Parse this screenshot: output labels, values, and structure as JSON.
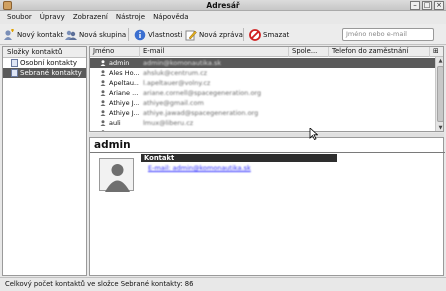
{
  "window": {
    "title": "Adresář"
  },
  "menu": [
    "Soubor",
    "Úpravy",
    "Zobrazení",
    "Nástroje",
    "Nápověda"
  ],
  "toolbar": {
    "new_contact": "Nový kontakt",
    "new_group": "Nová skupina",
    "properties": "Vlastnosti",
    "new_message": "Nová zpráva",
    "delete": "Smazat",
    "search_placeholder": "Jméno nebo e-mail"
  },
  "folders": {
    "header": "Složky kontaktů",
    "items": [
      "Osobní kontakty",
      "Sebrané kontakty"
    ],
    "selected_index": 1
  },
  "list": {
    "columns": [
      "Jméno",
      "E-mail",
      "Spole...",
      "Telefon do zaměstnání"
    ],
    "rows": [
      {
        "name": "admin",
        "email": "admin@komonautika.sk"
      },
      {
        "name": "Ales Ho...",
        "email": "ahsluk@centrum.cz"
      },
      {
        "name": "Apeltau...",
        "email": "l.apeltauer@volny.cz"
      },
      {
        "name": "Ariane ...",
        "email": "ariane.cornell@spacegeneration.org"
      },
      {
        "name": "Athiye J...",
        "email": "athiye@gmail.com"
      },
      {
        "name": "Athiye J...",
        "email": "athiye.jawad@spacegeneration.org"
      },
      {
        "name": "auli",
        "email": "lmux@liberu.cz"
      },
      {
        "name": "...",
        "email": "..."
      }
    ]
  },
  "card": {
    "name": "admin",
    "section": "Kontakt",
    "email": "E-mail: admin@komonautika.sk"
  },
  "status": "Celkový počet kontaktů ve složce Sebrané kontakty: 86",
  "colors": {
    "selection": "#5a5a5a",
    "link": "#2a2aff"
  }
}
